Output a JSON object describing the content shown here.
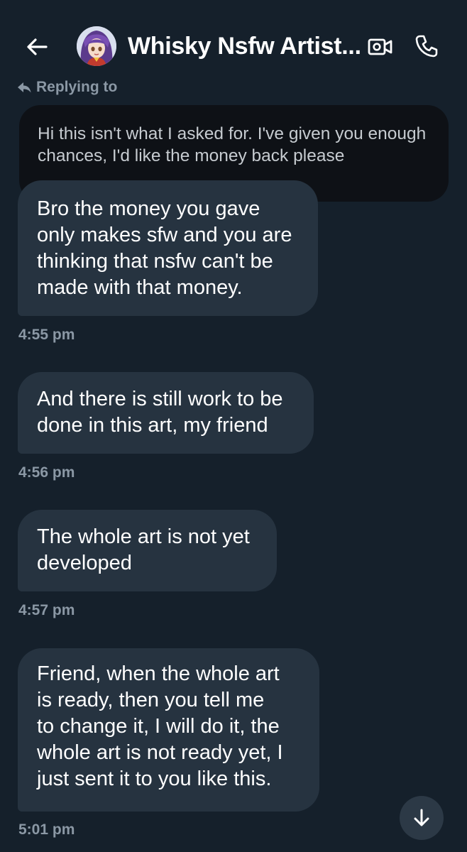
{
  "header": {
    "title": "Whisky Nsfw Artist...",
    "back_icon": "arrow-left-icon",
    "video_icon": "video-call-icon",
    "call_icon": "phone-icon"
  },
  "reply": {
    "label": "Replying to",
    "quoted_text": "Hi this isn't what I asked for. I've given you enough chances, I'd like the money back please"
  },
  "messages": [
    {
      "lines": [
        "Bro the money you gave",
        "only makes sfw and you are",
        "thinking that nsfw can't be",
        "made with that money."
      ],
      "time": "4:55 pm"
    },
    {
      "lines": [
        "And there is still work to be",
        "done in this art, my friend"
      ],
      "time": "4:56 pm"
    },
    {
      "lines": [
        "The whole art is not yet",
        "developed"
      ],
      "time": "4:57 pm"
    },
    {
      "lines": [
        "Friend, when the whole art",
        "is ready, then you tell me",
        "to change it, I will do it, the",
        "whole art is not ready yet, I",
        "just sent it to you like this."
      ],
      "time": "5:01 pm"
    }
  ],
  "colors": {
    "background": "#15202b",
    "bubble": "#263340",
    "quoted_background": "#0e1116",
    "muted_text": "#8b98a5"
  }
}
